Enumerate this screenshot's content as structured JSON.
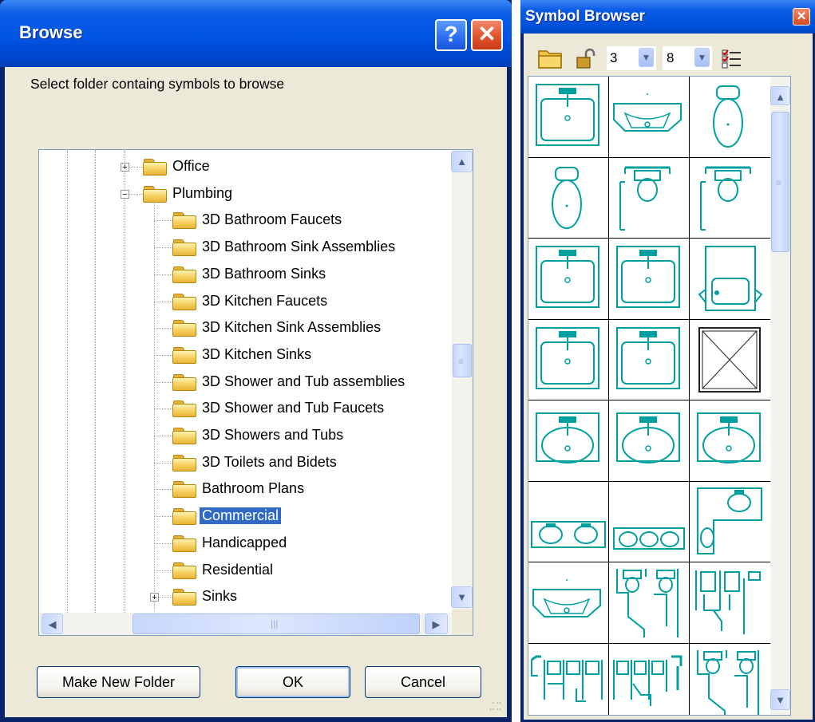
{
  "browse_dialog": {
    "title": "Browse",
    "help_glyph": "?",
    "close_glyph": "✕",
    "instruction": "Select folder containg symbols to browse",
    "tree": {
      "nodes": [
        {
          "label": "Office",
          "expander": "+"
        },
        {
          "label": "Plumbing",
          "expander": "−"
        },
        {
          "label": "3D Bathroom Faucets"
        },
        {
          "label": "3D Bathroom Sink Assemblies"
        },
        {
          "label": "3D Bathroom Sinks"
        },
        {
          "label": "3D Kitchen Faucets"
        },
        {
          "label": "3D Kitchen Sink Assemblies"
        },
        {
          "label": "3D Kitchen Sinks"
        },
        {
          "label": "3D Shower and Tub assemblies"
        },
        {
          "label": "3D Shower and Tub Faucets"
        },
        {
          "label": "3D Showers and Tubs"
        },
        {
          "label": "3D Toilets and Bidets"
        },
        {
          "label": "Bathroom Plans"
        },
        {
          "label": "Commercial",
          "selected": true
        },
        {
          "label": "Handicapped"
        },
        {
          "label": "Residential"
        },
        {
          "label": "Sinks",
          "expander": "+"
        }
      ],
      "selected_label": "Commercial"
    },
    "buttons": {
      "make_new_folder": "Make New Folder",
      "ok": "OK",
      "cancel": "Cancel"
    },
    "icons": {
      "folder": "folder-icon",
      "scroll_up": "scroll-up-arrow-icon",
      "scroll_down": "scroll-down-arrow-icon",
      "scroll_left": "scroll-left-arrow-icon",
      "scroll_right": "scroll-right-arrow-icon"
    }
  },
  "symbol_browser": {
    "title": "Symbol Browser",
    "close_glyph": "✕",
    "toolbar": {
      "open_folder_icon": "open-folder-icon",
      "lock_icon": "lock-icon",
      "columns_value": "3",
      "rows_value": "8",
      "options_icon": "options-list-icon"
    },
    "grid": {
      "columns": 3,
      "rows": 8,
      "symbol_color": "#00a0a0",
      "symbols": [
        "bathroom-sink-plan",
        "wall-sink-plan",
        "toilet-plan",
        "toilet-plan",
        "toilet-with-grab-bar",
        "toilet-with-grab-bar",
        "bathroom-sink-plan",
        "bathroom-sink-plan",
        "accessible-sink-plan",
        "bathroom-sink-plan",
        "bathroom-sink-plan",
        "shower-plan",
        "oval-sink-plan",
        "oval-sink-plan",
        "oval-sink-plan",
        "double-sink-vanity",
        "triple-sink-vanity",
        "corner-vanity-plan",
        "wall-sink-plan",
        "accessible-toilet-stall",
        "toilet-stall-pair",
        "urinal-stall-row",
        "toilet-stall-row",
        "accessible-toilet-stall"
      ]
    }
  }
}
